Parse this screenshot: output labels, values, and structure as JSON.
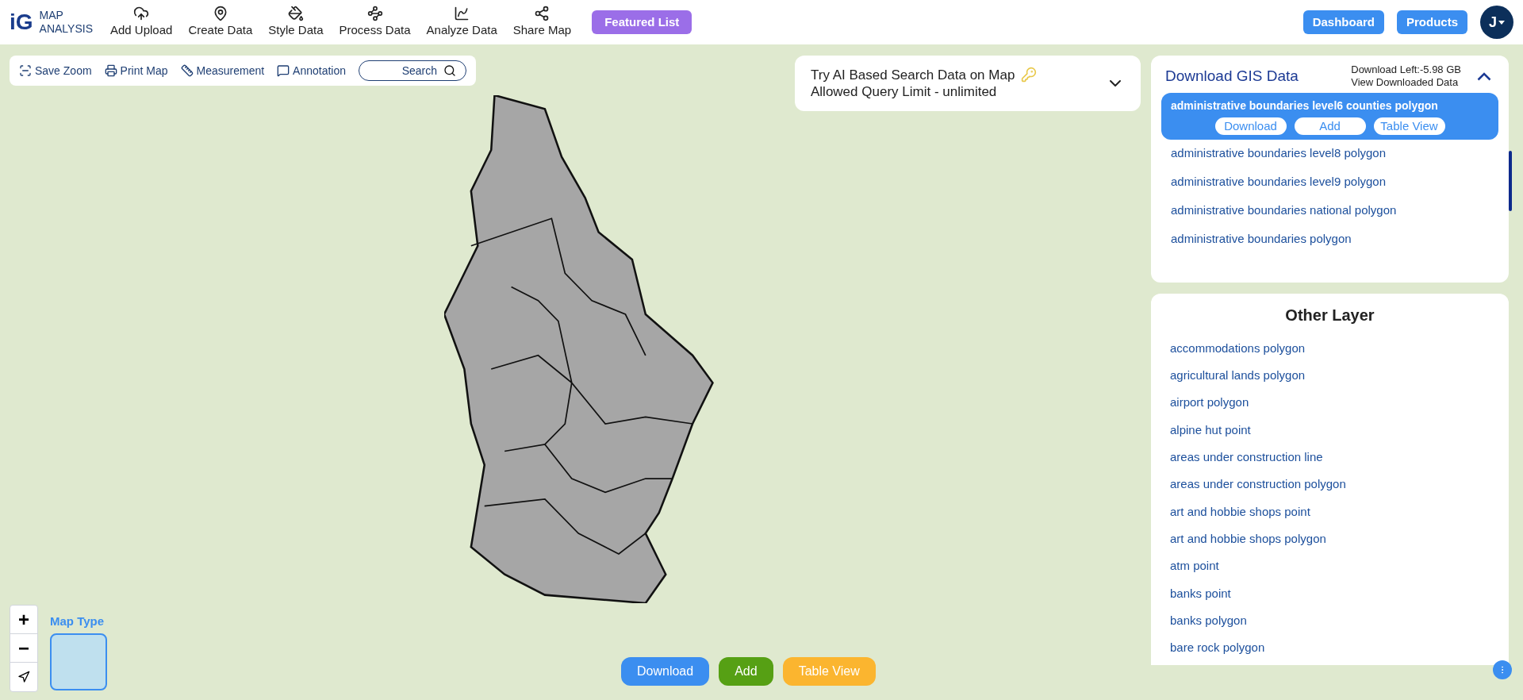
{
  "header": {
    "logo": {
      "mark": "iG",
      "line1": "MAP",
      "line2": "ANALYSIS"
    },
    "nav": [
      {
        "label": "Add Upload",
        "kind": "upload"
      },
      {
        "label": "Create Data",
        "kind": "pin"
      },
      {
        "label": "Style Data",
        "kind": "paint"
      },
      {
        "label": "Process Data",
        "kind": "process"
      },
      {
        "label": "Analyze Data",
        "kind": "analyze"
      },
      {
        "label": "Share Map",
        "kind": "share"
      }
    ],
    "featured": "Featured List",
    "dashboard": "Dashboard",
    "products": "Products",
    "avatar": "J",
    "avatar_menu_open": false
  },
  "toolbar": {
    "tools": [
      {
        "label": "Save Zoom",
        "kind": "zoom"
      },
      {
        "label": "Print Map",
        "kind": "print"
      },
      {
        "label": "Measurement",
        "kind": "measure"
      },
      {
        "label": "Annotation",
        "kind": "note"
      }
    ],
    "search": "Search"
  },
  "ai_box": {
    "line1": "Try AI Based Search Data on Map",
    "line2": "Allowed Query Limit - unlimited",
    "expanded": false
  },
  "gis_panel": {
    "title": "Download GIS Data",
    "download_left": "Download Left:-5.98 GB",
    "view_downloaded": "View Downloaded Data",
    "expanded": true,
    "layers": [
      {
        "name": "administrative boundaries level6 counties polygon",
        "selected": true,
        "actions": [
          "Download",
          "Add",
          "Table View"
        ]
      },
      {
        "name": "administrative boundaries level8 polygon",
        "selected": false
      },
      {
        "name": "administrative boundaries level9 polygon",
        "selected": false
      },
      {
        "name": "administrative boundaries national polygon",
        "selected": false
      },
      {
        "name": "administrative boundaries polygon",
        "selected": false
      }
    ]
  },
  "other_layer": {
    "title": "Other Layer",
    "items": [
      "accommodations polygon",
      "agricultural lands polygon",
      "airport polygon",
      "alpine hut point",
      "areas under construction line",
      "areas under construction polygon",
      "art and hobbie shops point",
      "art and hobbie shops polygon",
      "atm point",
      "banks point",
      "banks polygon",
      "bare rock polygon"
    ]
  },
  "map_controls": {
    "zoom_in": "+",
    "zoom_out": "−",
    "map_type": "Map Type"
  },
  "bottom_actions": [
    {
      "label": "Download",
      "kind": "download"
    },
    {
      "label": "Add",
      "kind": "add"
    },
    {
      "label": "Table View",
      "kind": "table"
    }
  ]
}
